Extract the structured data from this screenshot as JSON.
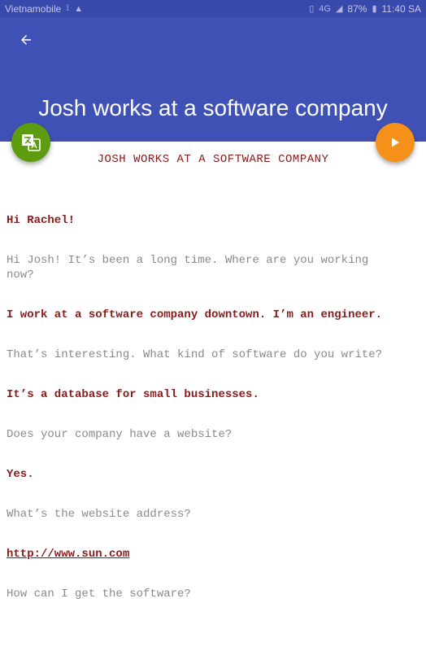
{
  "status_bar": {
    "carrier": "Vietnamobile",
    "battery": "87%",
    "time": "11:40 SA",
    "network": "4G"
  },
  "app_bar": {
    "title": "Josh works at a software company"
  },
  "content": {
    "heading": "JOSH WORKS AT A SOFTWARE COMPANY",
    "lines": [
      {
        "text": "Hi Rachel!",
        "style": "bold"
      },
      {
        "text": "Hi Josh! It’s been a long time. Where are you working now?",
        "style": "plain"
      },
      {
        "text": "I work at a software company downtown. I’m an engineer.",
        "style": "bold"
      },
      {
        "text": "That’s interesting. What kind of software do you write?",
        "style": "plain"
      },
      {
        "text": "It’s a database for small businesses.",
        "style": "bold"
      },
      {
        "text": "Does your company have a website?",
        "style": "plain"
      },
      {
        "text": "Yes.",
        "style": "bold"
      },
      {
        "text": "What’s the website address?",
        "style": "plain"
      },
      {
        "text": "http://www.sun.com",
        "style": "link"
      },
      {
        "text": "How can I get the software?",
        "style": "plain"
      }
    ]
  },
  "colors": {
    "status_bar": "#3949ab",
    "app_bar": "#3f51b5",
    "translate_fab": "#5d9c0f",
    "play_fab": "#f5901a",
    "speaker_a": "#8b1a1a",
    "speaker_b": "#8a8a8a"
  },
  "icons": {
    "back": "arrow-left-icon",
    "translate": "translate-icon",
    "play": "play-icon"
  }
}
